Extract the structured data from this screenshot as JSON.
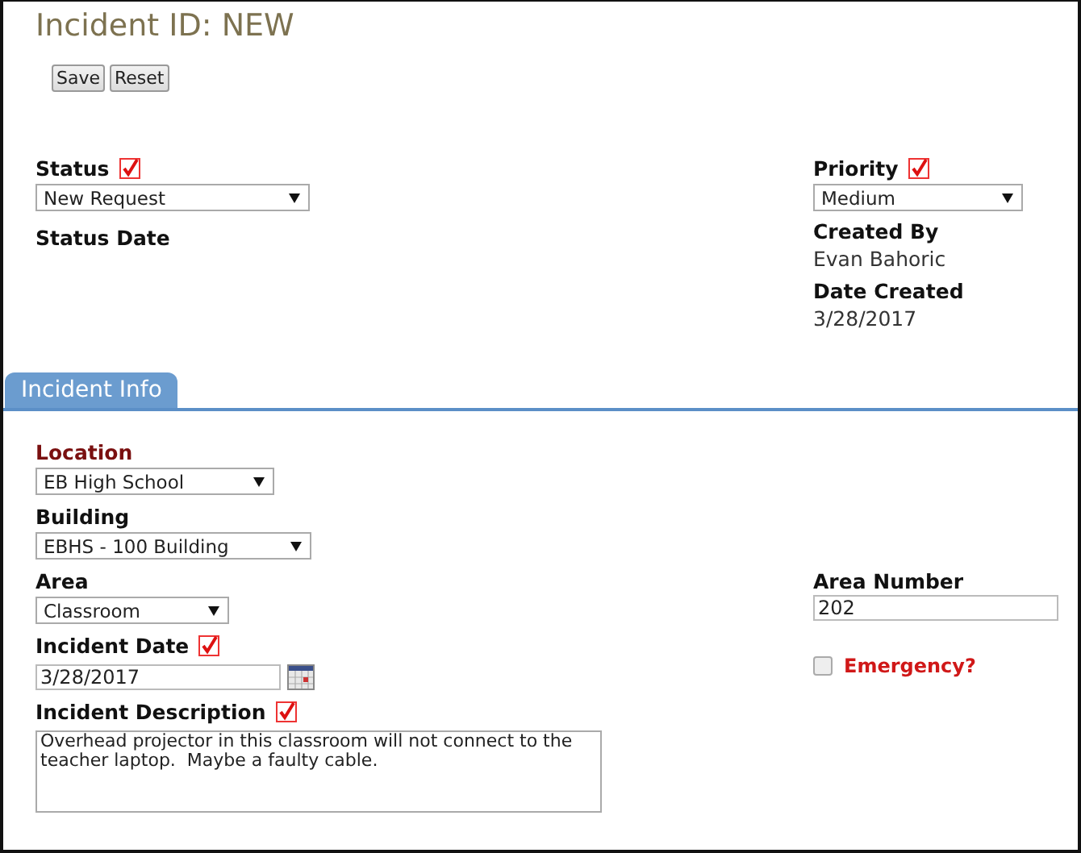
{
  "title": "Incident ID: NEW",
  "buttons": [
    "Save",
    "Reset"
  ],
  "header_left": [
    {
      "kind": "select",
      "label": "Status",
      "required": true,
      "highlighted": false,
      "value": "New Request"
    },
    {
      "kind": "readonly",
      "label": "Status Date",
      "required": false,
      "highlighted": false
    }
  ],
  "header_right": [
    {
      "kind": "select",
      "label": "Priority",
      "required": true,
      "highlighted": false,
      "value": "Medium"
    },
    {
      "kind": "readonly",
      "label": "Created By",
      "required": false,
      "highlighted": false,
      "value": "Evan Bahoric"
    },
    {
      "kind": "readonly",
      "label": "Date Created",
      "required": false,
      "highlighted": false,
      "value": "3/28/2017"
    }
  ],
  "tabs": [
    {
      "label": "Incident Info",
      "selected": true
    }
  ],
  "rows": [
    {
      "left": {
        "kind": "select",
        "label": "Location",
        "highlighted": true,
        "required": false,
        "value": "EB High School"
      }
    },
    {
      "left": {
        "kind": "select",
        "label": "Building",
        "highlighted": false,
        "required": false,
        "value": "EBHS - 100 Building"
      }
    },
    {
      "left": {
        "kind": "select",
        "label": "Area",
        "highlighted": false,
        "required": false,
        "value": "Classroom"
      },
      "right": {
        "kind": "text",
        "label": "Area Number",
        "highlighted": false,
        "required": false,
        "value": "202"
      }
    },
    {
      "left": {
        "kind": "date",
        "label": "Incident Date",
        "highlighted": false,
        "required": true,
        "value": "3/28/2017"
      },
      "right": {
        "kind": "checkbox",
        "label": "Emergency?",
        "checked": false
      }
    },
    {
      "left": {
        "kind": "textarea",
        "label": "Incident Description",
        "highlighted": false,
        "required": true,
        "value": "Overhead projector in this classroom will not connect to the teacher laptop.  Maybe a faulty cable."
      }
    }
  ]
}
